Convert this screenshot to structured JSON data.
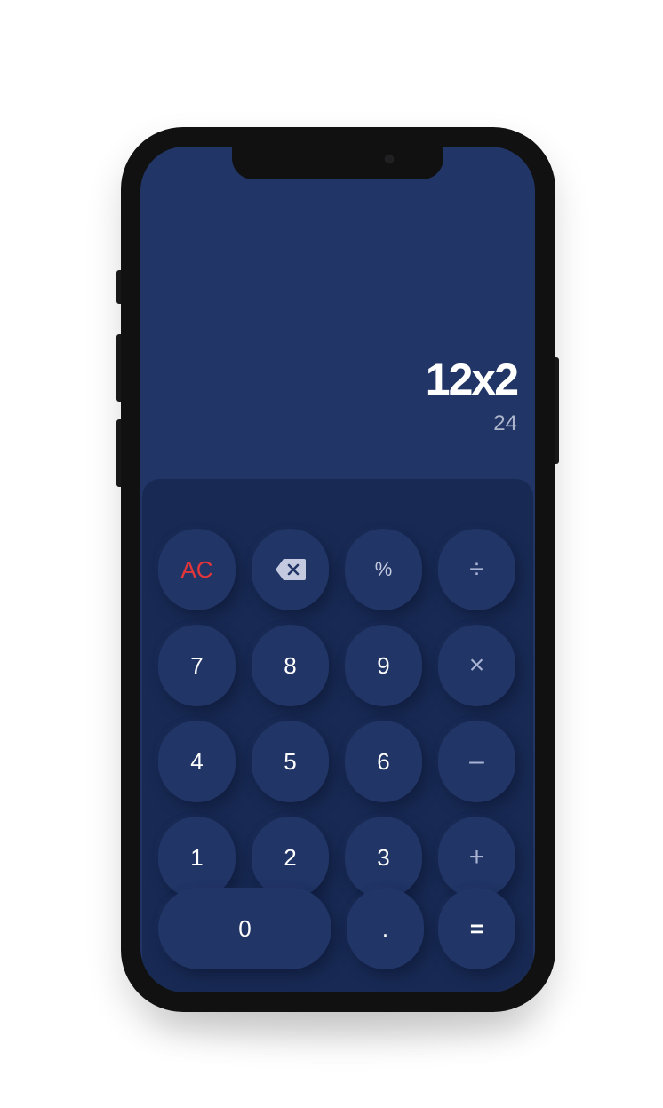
{
  "display": {
    "expression": "12x2",
    "result": "24"
  },
  "keypad": {
    "row1": [
      "AC",
      "",
      "%",
      "÷"
    ],
    "row2": [
      "7",
      "8",
      "9",
      "×"
    ],
    "row3": [
      "4",
      "5",
      "6",
      "–"
    ],
    "row4": [
      "1",
      "2",
      "3",
      "+"
    ],
    "row5": [
      "0",
      ".",
      "="
    ]
  },
  "icons": {
    "backspace": "backspace-icon"
  },
  "colors": {
    "screen_bg": "#213566",
    "keypad_bg": "#182a54",
    "key_bg": "#213566",
    "ac_red": "#e3363b",
    "operator": "#a9b4d4"
  }
}
